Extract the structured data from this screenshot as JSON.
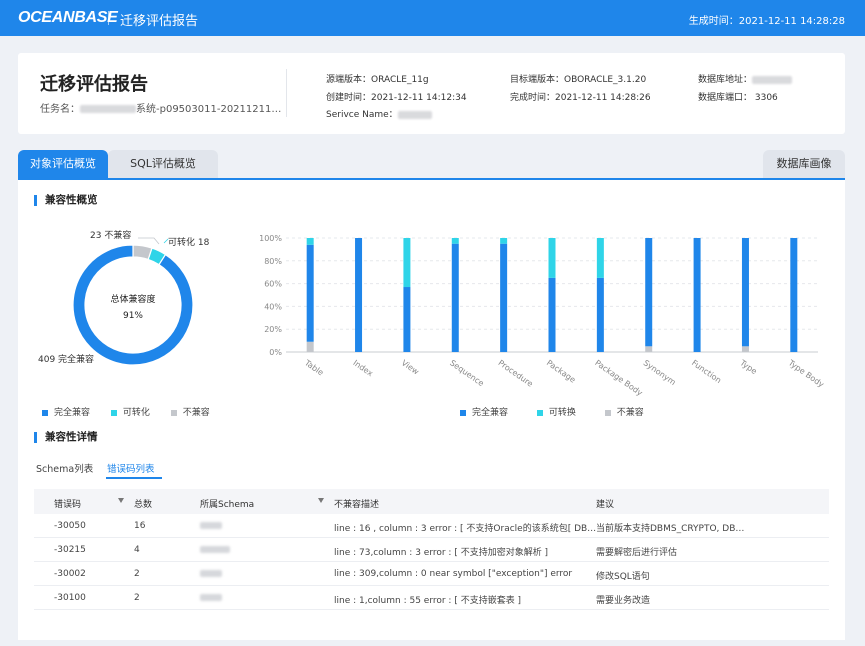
{
  "header": {
    "logo": "OCEANBASE",
    "title": "迁移评估报告",
    "generated_at": "生成时间：2021-12-11 14:28:28"
  },
  "info": {
    "title": "迁移评估报告",
    "task_prefix": "任务名：",
    "task_suffix": "系统-p09503011-20211211…",
    "source_version": "源端版本：ORACLE_11g",
    "created": "创建时间：2021-12-11 14:12:34",
    "service_name": "Serivce Name：",
    "target_version": "目标端版本：OBORACLE_3.1.20",
    "completed": "完成时间：2021-12-11 14:28:26",
    "db_address": "数据库地址：",
    "db_port": "数据库端口：  3306"
  },
  "tabs": {
    "object": "对象评估概览",
    "sql": "SQL评估概览",
    "profile": "数据库画像"
  },
  "overview": {
    "heading": "兼容性概览",
    "donut_center_label": "总体兼容度",
    "donut_center_value": "91%",
    "label_incompatible": "23 不兼容",
    "label_convertible": "可转化 18",
    "label_compatible": "409 完全兼容",
    "donut": {
      "compatible": 409,
      "convertible": 18,
      "incompatible": 23
    },
    "legend_left": [
      "完全兼容",
      "可转化",
      "不兼容"
    ],
    "legend_right": [
      "完全兼容",
      "可转换",
      "不兼容"
    ],
    "colors": {
      "compatible": "#1f86ea",
      "convertible": "#2fd4e8",
      "incompatible": "#c4c7cc"
    }
  },
  "chart_data": {
    "type": "bar",
    "stacked": true,
    "categories": [
      "Table",
      "Index",
      "View",
      "Sequence",
      "Procedure",
      "Package",
      "Package Body",
      "Synonym",
      "Function",
      "Type",
      "Type Body"
    ],
    "series": [
      {
        "name": "完全兼容",
        "values": [
          85,
          100,
          57,
          95,
          95,
          65,
          65,
          95,
          100,
          95,
          100
        ]
      },
      {
        "name": "可转换",
        "values": [
          6,
          0,
          43,
          5,
          5,
          35,
          35,
          0,
          0,
          0,
          0
        ]
      },
      {
        "name": "不兼容",
        "values": [
          9,
          0,
          0,
          0,
          0,
          0,
          0,
          5,
          0,
          5,
          0
        ]
      }
    ],
    "yticks": [
      "0%",
      "20%",
      "40%",
      "60%",
      "80%",
      "100%"
    ],
    "ylim": [
      0,
      100
    ],
    "grid": true
  },
  "details": {
    "heading": "兼容性详情",
    "subtab_schema": "Schema列表",
    "subtab_errors": "错误码列表",
    "columns": [
      "错误码",
      "总数",
      "所属Schema",
      "不兼容描述",
      "建议"
    ],
    "rows": [
      {
        "code": "-30050",
        "count": "16",
        "desc": "line : 16 , column : 3 error : [ 不支持Oracle的该系统包[ DB…",
        "advice": "当前版本支持DBMS_CRYPTO, DB…"
      },
      {
        "code": "-30215",
        "count": "4",
        "desc": "line : 73,column : 3 error : [ 不支持加密对象解析 ]",
        "advice": "需要解密后进行评估"
      },
      {
        "code": "-30002",
        "count": "2",
        "desc": "line : 309,column : 0 near symbol [\"exception\"] error",
        "advice": "修改SQL语句"
      },
      {
        "code": "-30100",
        "count": "2",
        "desc": "line : 1,column : 55 error : [ 不支持嵌套表 ]",
        "advice": "需要业务改造"
      }
    ]
  }
}
